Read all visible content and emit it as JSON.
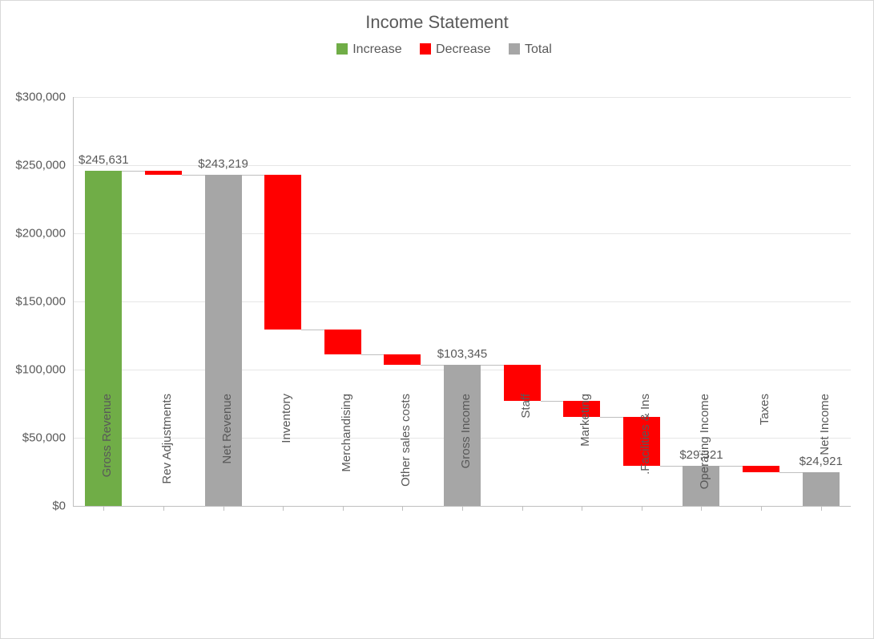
{
  "title": "Income Statement",
  "legend": {
    "increase": "Increase",
    "decrease": "Decrease",
    "total": "Total"
  },
  "colors": {
    "increase": "#70ad47",
    "decrease": "#ff0000",
    "total": "#a6a6a6"
  },
  "yAxis": {
    "min": 0,
    "max": 300000,
    "step": 50000,
    "format": "currency"
  },
  "labeled": {
    "Gross Revenue": "$245,631",
    "Net Revenue": "$243,219",
    "Gross Income": "$103,345",
    "Operating Income": "$29,321",
    "Net Income": "$24,921"
  },
  "chart_data": {
    "type": "waterfall",
    "title": "Income Statement",
    "xlabel": "",
    "ylabel": "",
    "ylim": [
      0,
      300000
    ],
    "categories": [
      "Gross Revenue",
      "Rev Adjustments",
      "Net Revenue",
      "Inventory",
      "Merchandising",
      "Other sales costs",
      "Gross Income",
      "Staff",
      "Marketing",
      "Facilities & Ins.",
      "Operating Income",
      "Taxes",
      "Net Income"
    ],
    "items": [
      {
        "name": "Gross Revenue",
        "kind": "increase",
        "value": 245631,
        "base": 0,
        "top": 245631,
        "label": "$245,631"
      },
      {
        "name": "Rev Adjustments",
        "kind": "decrease",
        "value": -2412,
        "base": 243219,
        "top": 245631
      },
      {
        "name": "Net Revenue",
        "kind": "total",
        "value": 243219,
        "base": 0,
        "top": 243219,
        "label": "$243,219"
      },
      {
        "name": "Inventory",
        "kind": "decrease",
        "value": -114000,
        "base": 129219,
        "top": 243219
      },
      {
        "name": "Merchandising",
        "kind": "decrease",
        "value": -18000,
        "base": 111219,
        "top": 129219
      },
      {
        "name": "Other sales costs",
        "kind": "decrease",
        "value": -7874,
        "base": 103345,
        "top": 111219
      },
      {
        "name": "Gross Income",
        "kind": "total",
        "value": 103345,
        "base": 0,
        "top": 103345,
        "label": "$103,345"
      },
      {
        "name": "Staff",
        "kind": "decrease",
        "value": -26000,
        "base": 77345,
        "top": 103345
      },
      {
        "name": "Marketing",
        "kind": "decrease",
        "value": -12000,
        "base": 65345,
        "top": 77345
      },
      {
        "name": "Facilities & Ins.",
        "kind": "decrease",
        "value": -36024,
        "base": 29321,
        "top": 65345
      },
      {
        "name": "Operating Income",
        "kind": "total",
        "value": 29321,
        "base": 0,
        "top": 29321,
        "label": "$29,321"
      },
      {
        "name": "Taxes",
        "kind": "decrease",
        "value": -4400,
        "base": 24921,
        "top": 29321
      },
      {
        "name": "Net Income",
        "kind": "total",
        "value": 24921,
        "base": 0,
        "top": 24921,
        "label": "$24,921"
      }
    ]
  }
}
